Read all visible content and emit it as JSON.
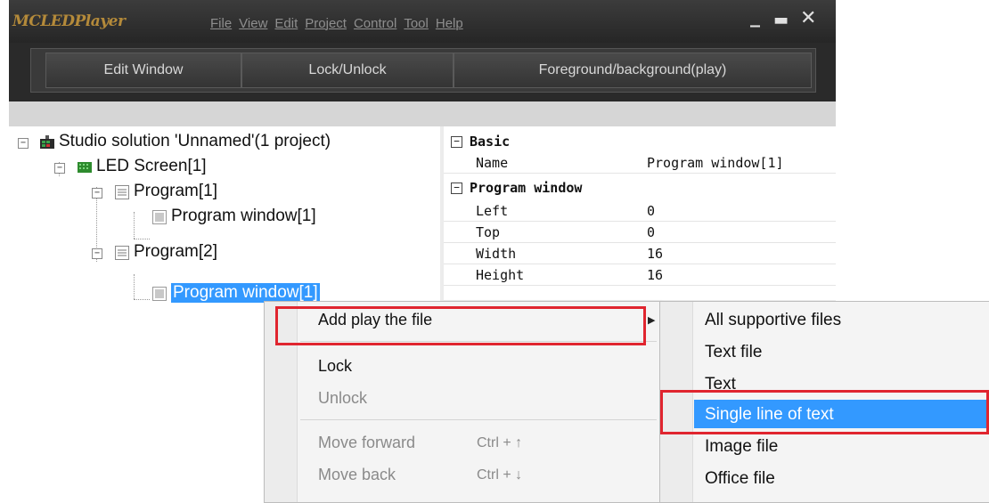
{
  "app": {
    "title": "MCLEDPlayer",
    "menu": [
      "File",
      "View",
      "Edit",
      "Project",
      "Control",
      "Tool",
      "Help"
    ],
    "window_controls": {
      "minimize": "_",
      "maximize": "▬",
      "close": "✕"
    }
  },
  "toolbar": {
    "edit_window": "Edit Window",
    "lock_unlock": "Lock/Unlock",
    "fg_bg": "Foreground/background(play)"
  },
  "tree": {
    "solution": "Studio solution 'Unnamed'(1 project)",
    "screen": "LED Screen[1]",
    "program1": "Program[1]",
    "program1_window": "Program window[1]",
    "program2": "Program[2]",
    "program2_window": "Program window[1]"
  },
  "properties": {
    "basic_header": "Basic",
    "name_key": "Name",
    "name_value": "Program window[1]",
    "program_window_header": "Program window",
    "rows": [
      {
        "key": "Left",
        "value": "0"
      },
      {
        "key": "Top",
        "value": "0"
      },
      {
        "key": "Width",
        "value": "16"
      },
      {
        "key": "Height",
        "value": "16"
      }
    ]
  },
  "context_menu": {
    "add_play_file": "Add play the file",
    "lock": "Lock",
    "unlock": "Unlock",
    "move_forward": "Move forward",
    "move_forward_shortcut": "Ctrl + ↑",
    "move_back": "Move back",
    "move_back_shortcut": "Ctrl + ↓"
  },
  "submenu": {
    "items": [
      "All supportive files",
      "Text file",
      "Text",
      "Single line of text",
      "Image file",
      "Office file"
    ],
    "highlighted": "Single line of text"
  },
  "colors": {
    "selection": "#3399ff",
    "annotation_red": "#e0252f",
    "title_gold": "#b48a3a"
  }
}
